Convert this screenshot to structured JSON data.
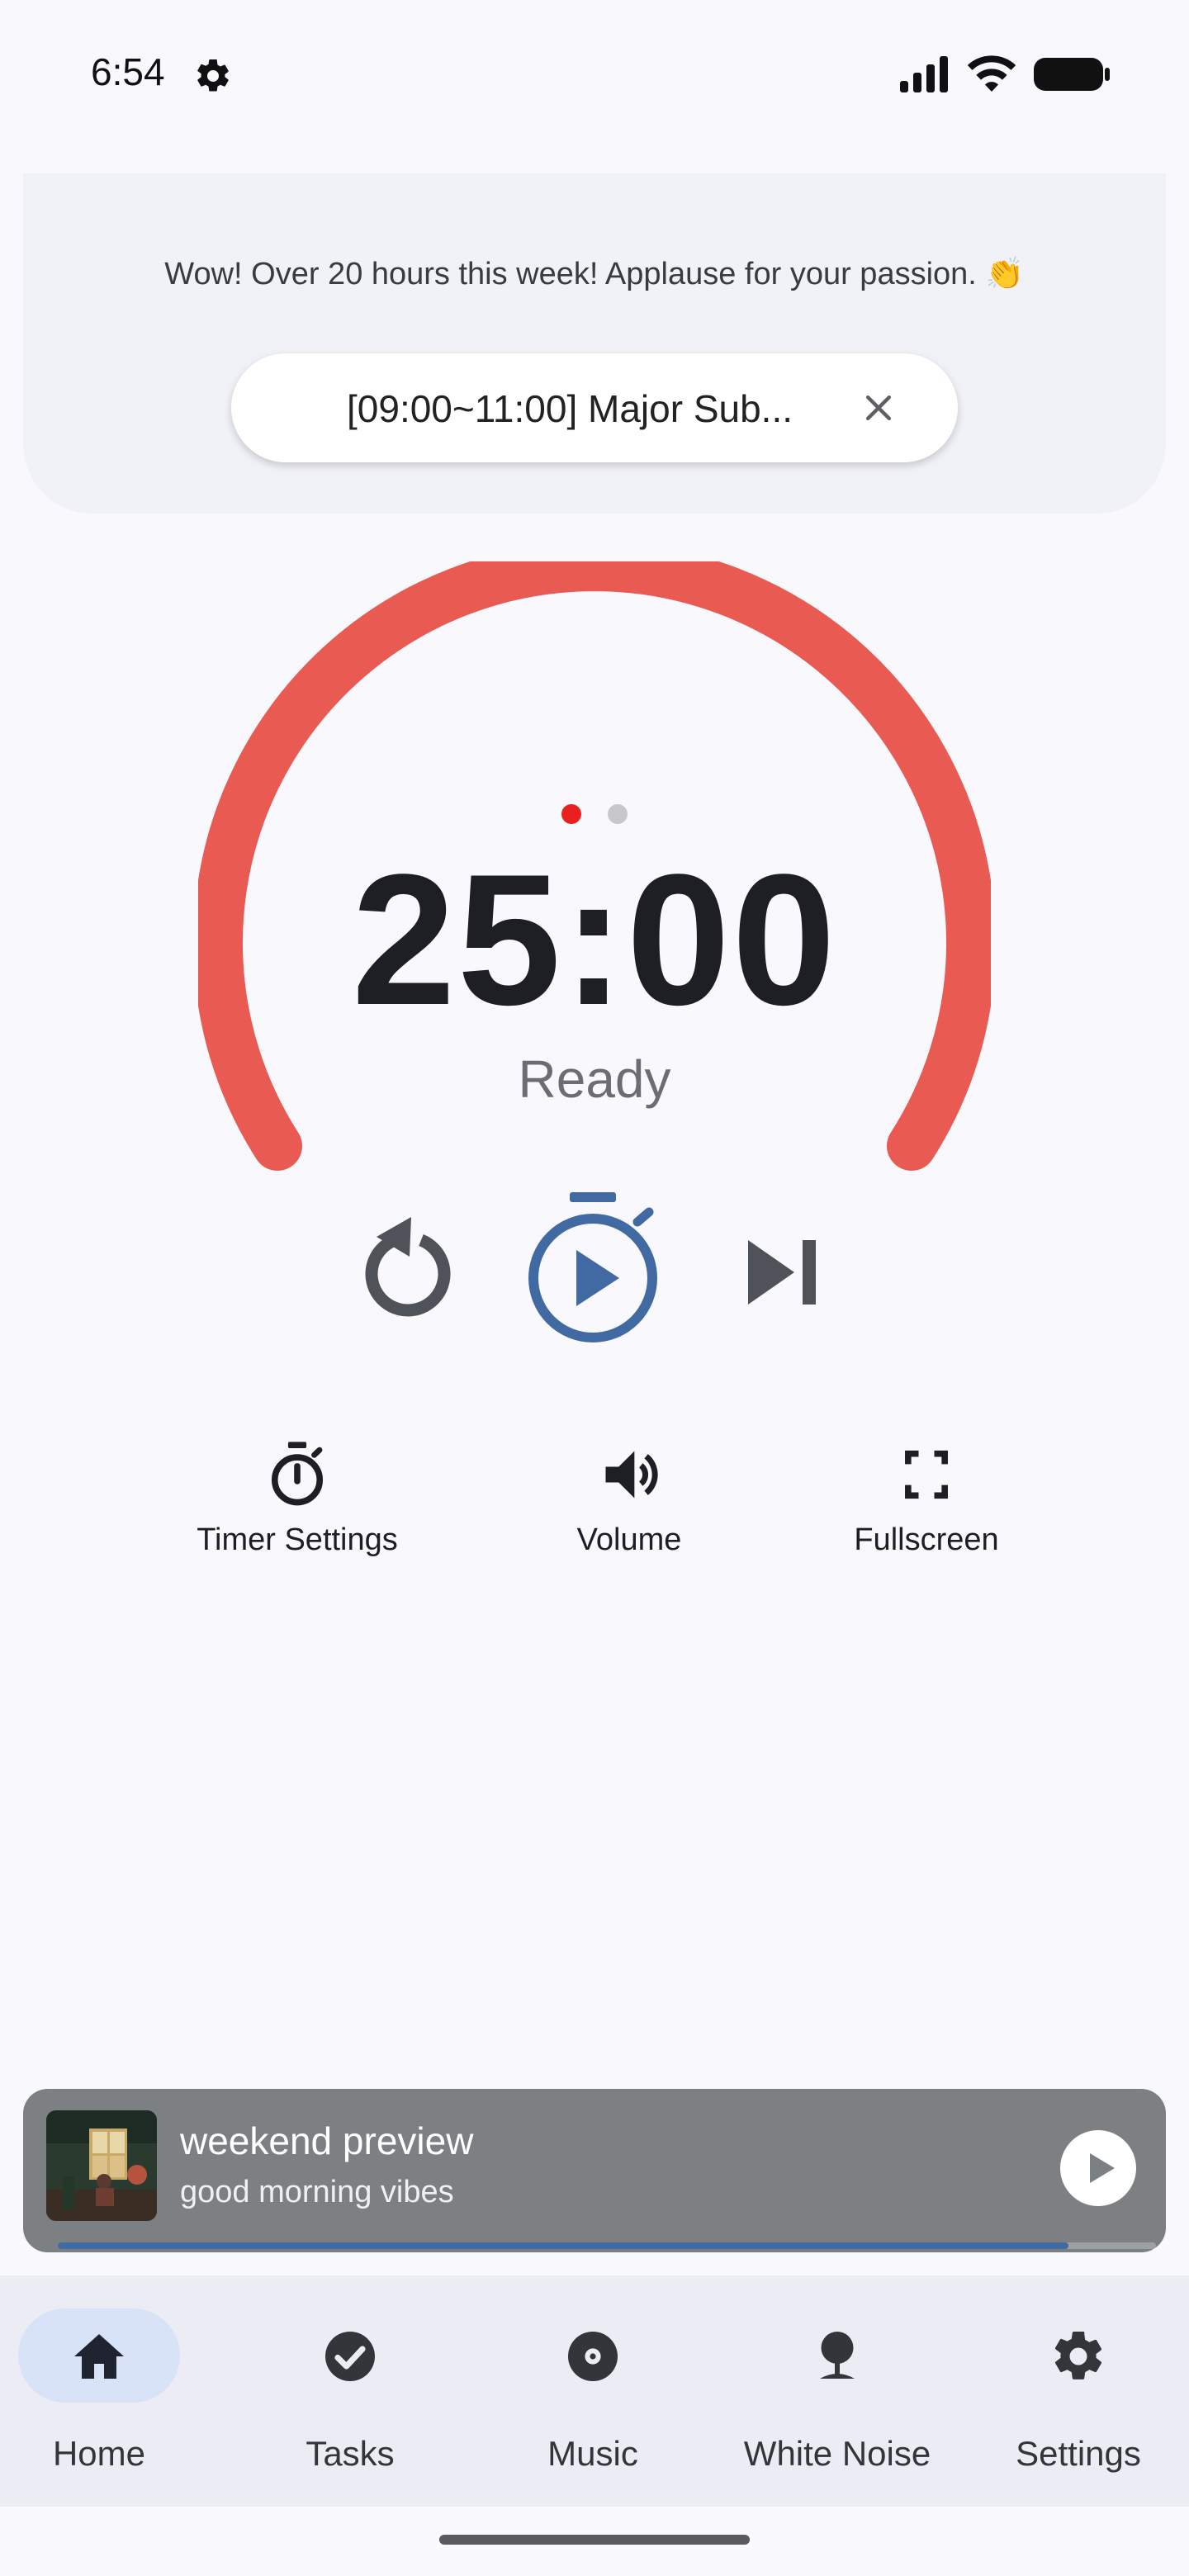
{
  "status_bar": {
    "time": "6:54",
    "icons": [
      "settings-gear-icon",
      "signal-icon",
      "wifi-icon",
      "battery-icon"
    ]
  },
  "top_card": {
    "motivation": "Wow! Over 20 hours this week! Applause for your passion. 👏",
    "task_chip": "[09:00~11:00] Major Sub...",
    "task_chip_close_icon": "close-icon"
  },
  "timer": {
    "value": "25:00",
    "status": "Ready",
    "page_dots": {
      "count": 2,
      "active_index": 0
    },
    "ring_color": "#E95A52"
  },
  "controls": {
    "reset_icon": "reset-icon",
    "start_icon": "play-stopwatch-icon",
    "skip_icon": "skip-next-icon"
  },
  "quick_actions": [
    {
      "label": "Timer Settings",
      "icon": "timer-icon"
    },
    {
      "label": "Volume",
      "icon": "volume-icon"
    },
    {
      "label": "Fullscreen",
      "icon": "fullscreen-icon"
    }
  ],
  "mini_player": {
    "title": "weekend preview",
    "subtitle": "good morning vibes",
    "progress": 0.92,
    "play_icon": "play-circle-icon"
  },
  "bottom_nav": {
    "active": "Home",
    "items": [
      {
        "label": "Home",
        "icon": "home-icon"
      },
      {
        "label": "Tasks",
        "icon": "check-circle-icon"
      },
      {
        "label": "Music",
        "icon": "disc-icon"
      },
      {
        "label": "White Noise",
        "icon": "tree-icon"
      },
      {
        "label": "Settings",
        "icon": "settings-icon"
      }
    ]
  },
  "colors": {
    "accent_red": "#E95A52",
    "accent_blue": "#416AA3",
    "background": "#F8F8FD"
  }
}
